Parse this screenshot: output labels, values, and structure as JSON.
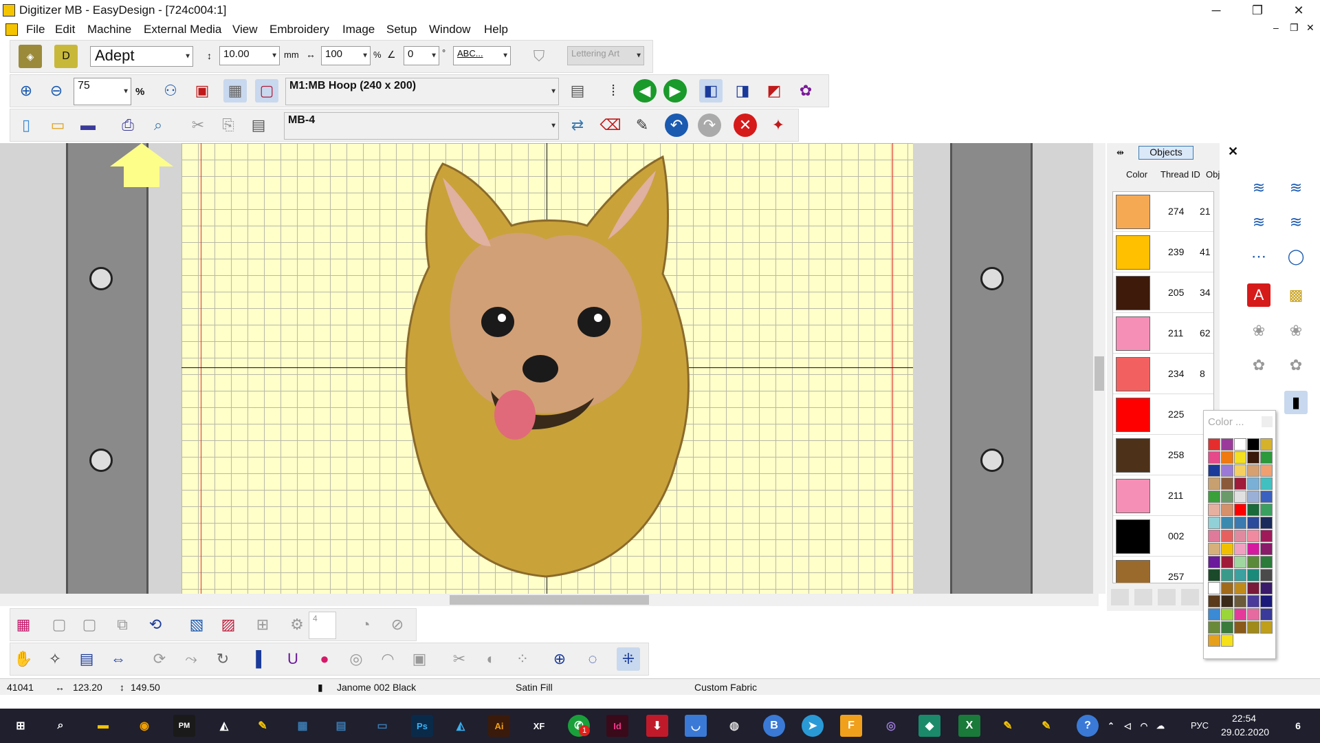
{
  "window": {
    "title": "Digitizer MB - EasyDesign - [724c004:1]",
    "minimize": "─",
    "restore": "❐",
    "close": "✕"
  },
  "menu": [
    "File",
    "Edit",
    "Machine",
    "External Media",
    "View",
    "Embroidery",
    "Image",
    "Setup",
    "Window",
    "Help"
  ],
  "toolbar1": {
    "font": "Adept",
    "height": "10.00",
    "height_unit": "mm",
    "width_pct": "100",
    "pct_symbol": "%",
    "angle": "0",
    "angle_unit": "°",
    "abc": "ABC...",
    "lettering": "Lettering Art"
  },
  "toolbar2": {
    "zoom": "75",
    "zoom_pct": "%",
    "hoop": "M1:MB Hoop (240 x 200)"
  },
  "toolbar3": {
    "machine": "MB-4"
  },
  "panel": {
    "tab": "Objects",
    "headers": [
      "Color",
      "Thread ID",
      "Obj"
    ],
    "rows": [
      {
        "color": "#f5a952",
        "thread": "274",
        "obj": "21"
      },
      {
        "color": "#ffc000",
        "thread": "239",
        "obj": "41"
      },
      {
        "color": "#3d1a0a",
        "thread": "205",
        "obj": "34"
      },
      {
        "color": "#f58fb6",
        "thread": "211",
        "obj": "62"
      },
      {
        "color": "#f36060",
        "thread": "234",
        "obj": "8"
      },
      {
        "color": "#ff0000",
        "thread": "225",
        "obj": ""
      },
      {
        "color": "#4d3219",
        "thread": "258",
        "obj": ""
      },
      {
        "color": "#f58fb6",
        "thread": "211",
        "obj": ""
      },
      {
        "color": "#000000",
        "thread": "002",
        "obj": ""
      },
      {
        "color": "#9a6a2c",
        "thread": "257",
        "obj": ""
      }
    ]
  },
  "color_popup": {
    "title": "Color ...",
    "colors": [
      "#e62d2d",
      "#9b3a9a",
      "#ffffff",
      "#000000",
      "#d6b22a",
      "#e64a8a",
      "#f07a10",
      "#f5e020",
      "#3a1a0a",
      "#2a9a3a",
      "#1a3a9a",
      "#9a7ad6",
      "#f5d060",
      "#d6a070",
      "#f0a070",
      "#c8a070",
      "#8a5a3a",
      "#a01a3a",
      "#7ab0d6",
      "#40c0c0",
      "#3aa03a",
      "#6a9a6a",
      "#e0e0e0",
      "#9ab0d6",
      "#3a60c0",
      "#e6b0a0",
      "#d6906a",
      "#ff0000",
      "#1a6a3a",
      "#3aa060",
      "#90d0d6",
      "#3a8ab0",
      "#3a7ab0",
      "#2a4a9a",
      "#1a2a5a",
      "#e07a9a",
      "#e66060",
      "#e08aa0",
      "#f08aa0",
      "#a01a5a",
      "#d6b07a",
      "#f0c000",
      "#f0a0c0",
      "#d61aa0",
      "#8a1a6a",
      "#6a1a9a",
      "#a01a3a",
      "#a0d6a0",
      "#5a8a3a",
      "#2a7a3a",
      "#1a4a2a",
      "#3a9a8a",
      "#3aa0a0",
      "#1a8a7a",
      "#4a4a4a",
      "#ffffff",
      "#a06a1a",
      "#c08a1a",
      "#7a1a3a",
      "#3a1a6a",
      "#5a3a1a",
      "#3a2a1a",
      "#6a5a3a",
      "#4a3a9a",
      "#1a1a7a",
      "#3a8ad6",
      "#9ad63a",
      "#e63a9a",
      "#e66aa0",
      "#3a3a9a",
      "#6a8a3a",
      "#3a7a3a",
      "#8a5a1a",
      "#a08a1a",
      "#c0a01a",
      "#e6a01a",
      "#f5e01a"
    ]
  },
  "status": {
    "stitches": "41041",
    "width": "123.20",
    "height": "149.50",
    "thread": "Janome 002 Black",
    "fill": "Satin Fill",
    "fabric": "Custom Fabric"
  },
  "bottom_tools": {
    "counter": "4"
  },
  "taskbar": {
    "lang": "РУС",
    "time": "22:54",
    "date": "29.02.2020",
    "notif": "6",
    "badge": "1"
  }
}
